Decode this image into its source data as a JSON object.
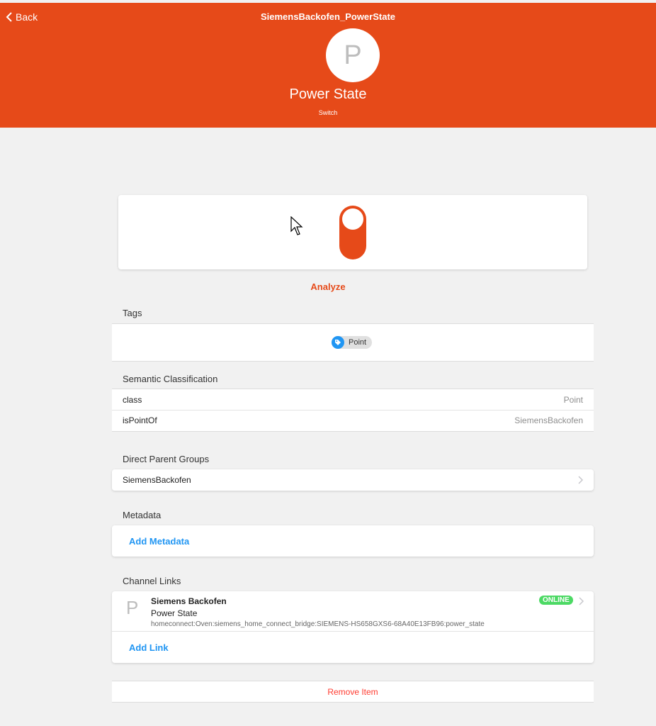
{
  "navbar": {
    "back_label": "Back",
    "title": "SiemensBackofen_PowerState"
  },
  "item": {
    "avatar_letter": "P",
    "label": "Power State",
    "type": "Switch",
    "state": "OFF"
  },
  "colors": {
    "accent": "#e64a19",
    "link": "#2196f3",
    "online": "#4cd964",
    "danger": "#ff3b30"
  },
  "analyze_label": "Analyze",
  "tags": {
    "title": "Tags",
    "items": [
      {
        "label": "Point",
        "icon": "tag-icon"
      }
    ]
  },
  "semantic": {
    "title": "Semantic Classification",
    "rows": [
      {
        "key": "class",
        "value": "Point"
      },
      {
        "key": "isPointOf",
        "value": "SiemensBackofen"
      }
    ]
  },
  "parent_groups": {
    "title": "Direct Parent Groups",
    "items": [
      {
        "label": "SiemensBackofen"
      }
    ]
  },
  "metadata": {
    "title": "Metadata",
    "add_label": "Add Metadata"
  },
  "channel_links": {
    "title": "Channel Links",
    "links": [
      {
        "letter": "P",
        "thing": "Siemens Backofen",
        "channel": "Power State",
        "uid": "homeconnect:Oven:siemens_home_connect_bridge:SIEMENS-HS658GXS6-68A40E13FB96:power_state",
        "status": "ONLINE"
      }
    ],
    "add_label": "Add Link"
  },
  "remove_label": "Remove Item"
}
